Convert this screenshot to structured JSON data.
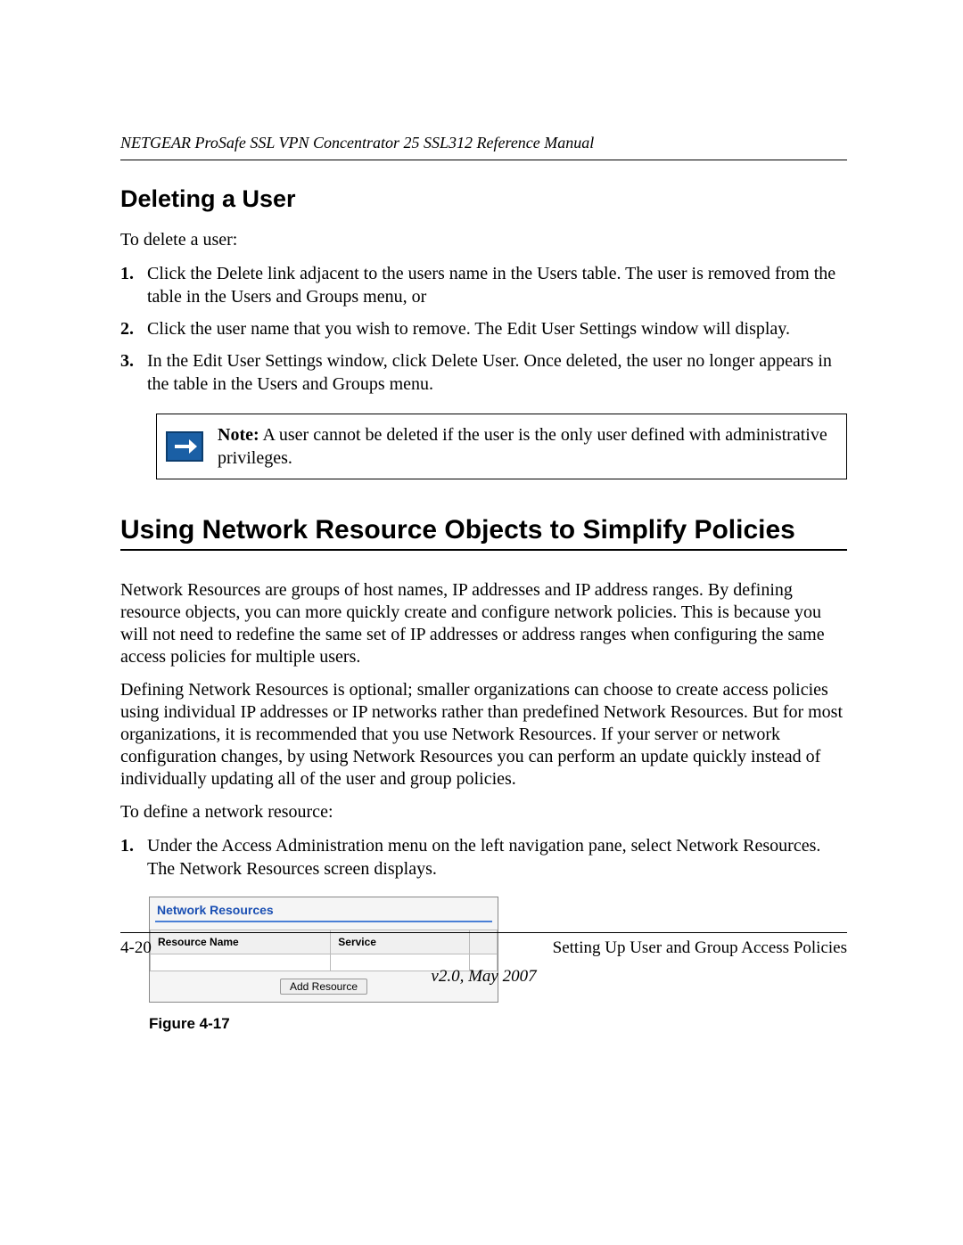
{
  "header": {
    "running": "NETGEAR ProSafe SSL VPN Concentrator 25 SSL312 Reference Manual"
  },
  "section_deleting": {
    "title": "Deleting a User",
    "intro": "To delete a user:",
    "steps": [
      "Click the Delete link adjacent to the users name in the Users table. The user is removed from the table in the Users and Groups menu, or",
      "Click the user name that you wish to remove. The Edit User Settings window will display.",
      "In the Edit User Settings window, click Delete User. Once deleted, the user no longer appears in the table in the Users and Groups menu."
    ]
  },
  "note": {
    "label": "Note:",
    "text": "A user cannot be deleted if the user is the only user defined with administrative privileges."
  },
  "section_network": {
    "title": "Using Network Resource Objects to Simplify Policies",
    "para1": "Network Resources are groups of host names, IP addresses and IP address ranges. By defining resource objects, you can more quickly create and configure network policies. This is because you will not need to redefine the same set of IP addresses or address ranges when configuring the same access policies for multiple users.",
    "para2": "Defining Network Resources is optional; smaller organizations can choose to create access policies using individual IP addresses or IP networks rather than predefined Network Resources. But for most organizations, it is recommended that you use Network Resources. If your server or network configuration changes, by using Network Resources you can perform an update quickly instead of individually updating all of the user and group policies.",
    "intro2": "To define a network resource:",
    "steps": [
      "Under the Access Administration menu on the left navigation pane, select Network Resources. The Network Resources screen displays."
    ]
  },
  "figure": {
    "panel_title": "Network Resources",
    "col1": "Resource Name",
    "col2": "Service",
    "button": "Add Resource",
    "caption": "Figure 4-17"
  },
  "footer": {
    "page": "4-20",
    "chapter": "Setting Up User and Group Access Policies",
    "version": "v2.0, May 2007"
  }
}
